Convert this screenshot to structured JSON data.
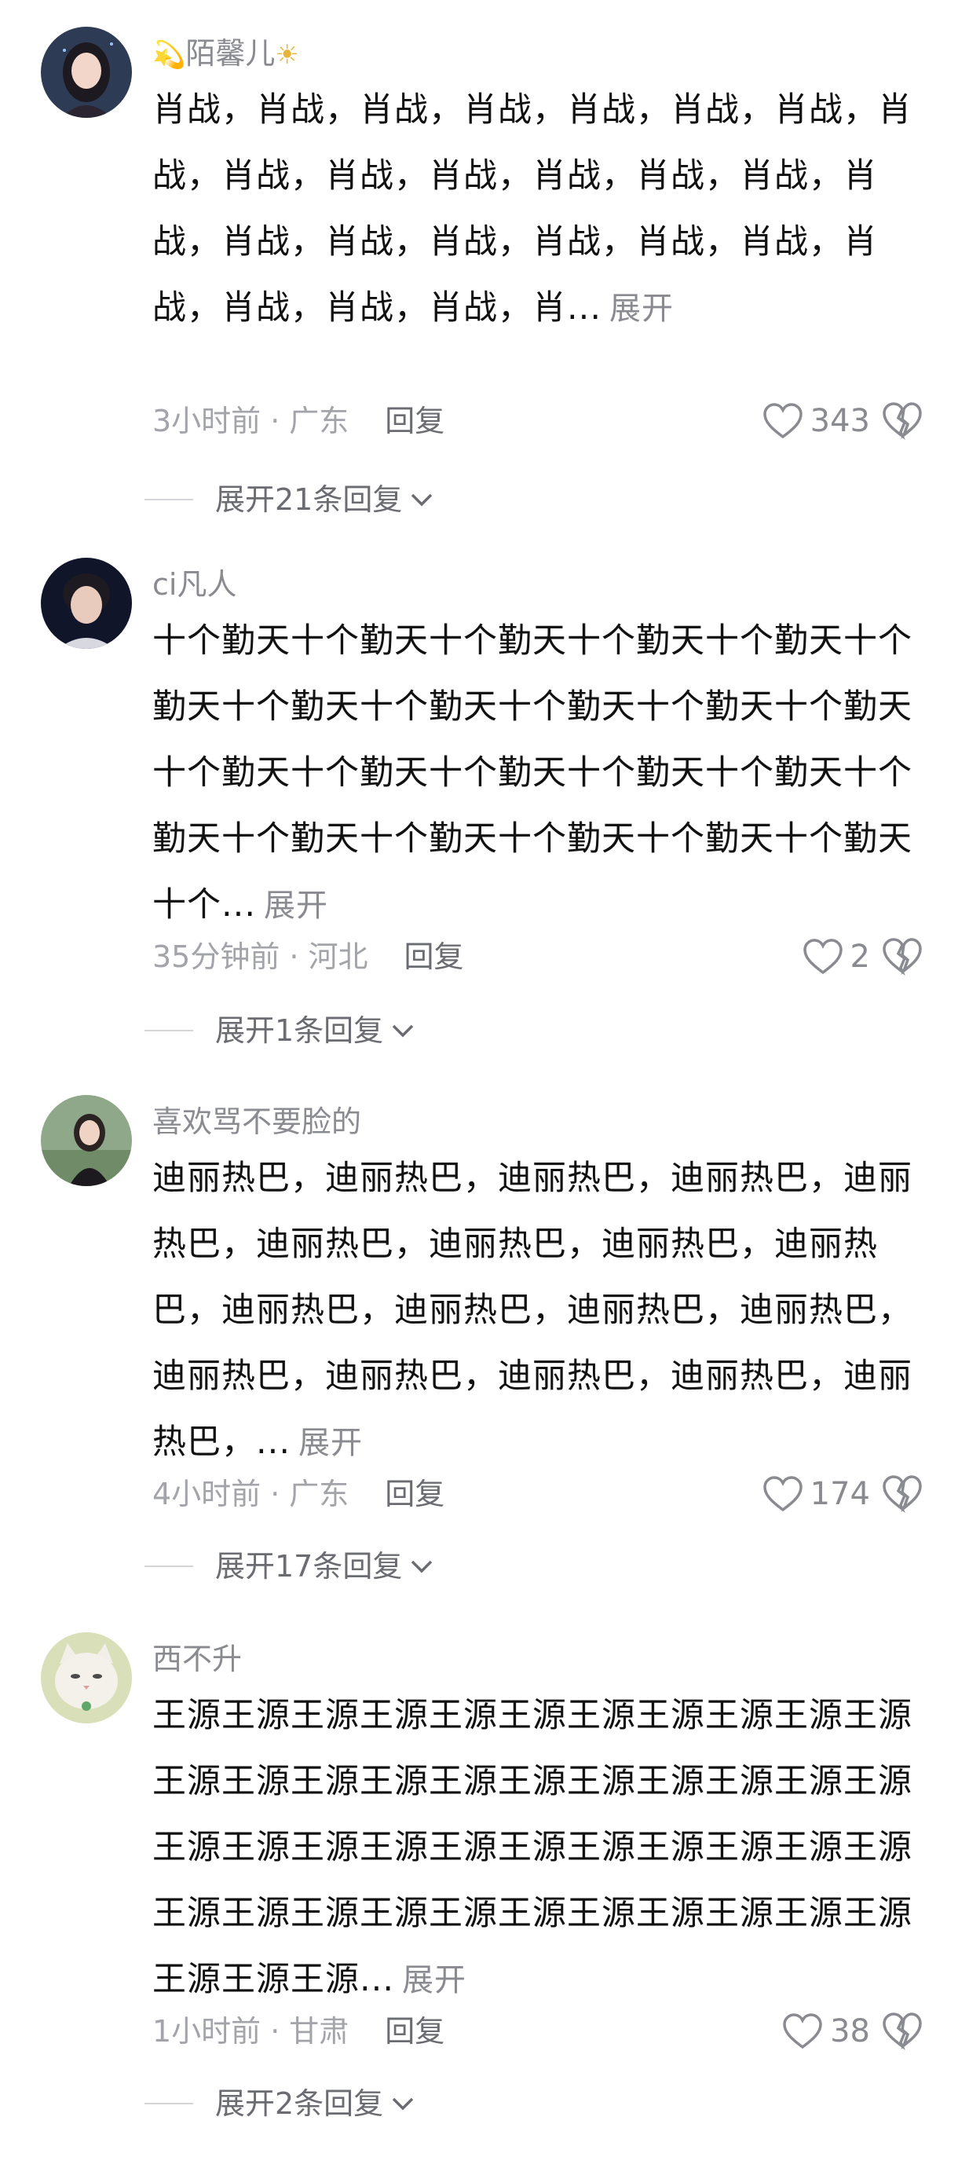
{
  "comments": [
    {
      "username": "陌馨儿",
      "username_prefix_emoji": "💫",
      "username_suffix_emoji": "☀",
      "text": "肖战，肖战，肖战，肖战，肖战，肖战，肖战，肖战，肖战，肖战，肖战，肖战，肖战，肖战，肖战，肖战，肖战，肖战，肖战，肖战，肖战，肖战，肖战，肖战，肖战，肖...",
      "expand_label": "展开",
      "time": "3小时前",
      "location": "广东",
      "reply_label": "回复",
      "likes": "343",
      "expand_replies": "展开21条回复",
      "avatar_icon": "girl-portrait-avatar"
    },
    {
      "username": "ci凡人",
      "text": "十个勤天十个勤天十个勤天十个勤天十个勤天十个勤天十个勤天十个勤天十个勤天十个勤天十个勤天十个勤天十个勤天十个勤天十个勤天十个勤天十个勤天十个勤天十个勤天十个勤天十个勤天十个勤天十个...",
      "expand_label": "展开",
      "time": "35分钟前",
      "location": "河北",
      "reply_label": "回复",
      "likes": "2",
      "expand_replies": "展开1条回复",
      "avatar_icon": "boy-portrait-avatar"
    },
    {
      "username": "喜欢骂不要脸的",
      "text": "迪丽热巴，迪丽热巴，迪丽热巴，迪丽热巴，迪丽热巴，迪丽热巴，迪丽热巴，迪丽热巴，迪丽热巴，迪丽热巴，迪丽热巴，迪丽热巴，迪丽热巴，迪丽热巴，迪丽热巴，迪丽热巴，迪丽热巴，迪丽热巴，...",
      "expand_label": "展开",
      "time": "4小时前",
      "location": "广东",
      "reply_label": "回复",
      "likes": "174",
      "expand_replies": "展开17条回复",
      "avatar_icon": "woman-outdoor-avatar"
    },
    {
      "username": "西不升",
      "text": "王源王源王源王源王源王源王源王源王源王源王源王源王源王源王源王源王源王源王源王源王源王源王源王源王源王源王源王源王源王源王源王源王源王源王源王源王源王源王源王源王源王源王源王源王源王源王源...",
      "expand_label": "展开",
      "time": "1小时前",
      "location": "甘肃",
      "reply_label": "回复",
      "likes": "38",
      "expand_replies": "展开2条回复",
      "avatar_icon": "cat-avatar"
    }
  ],
  "icons": {
    "like": "heart-outline-icon",
    "dislike": "broken-heart-icon",
    "chevron": "chevron-down-icon"
  },
  "colors": {
    "text": "#111111",
    "secondary": "#8a8b91",
    "meta": "#a3a4a9"
  }
}
